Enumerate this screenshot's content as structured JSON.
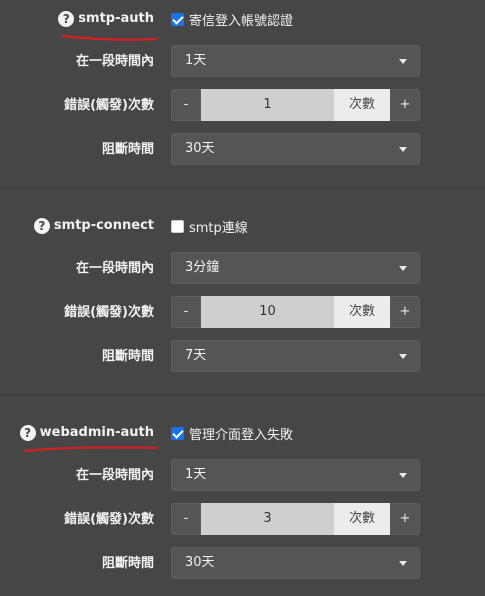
{
  "sections": [
    {
      "name": "smtp-auth",
      "checkbox_label": "寄信登入帳號認證",
      "checked": true,
      "period_label": "在一段時間內",
      "period_value": "1天",
      "count_label": "錯誤(觸發)次數",
      "count_value": "1",
      "count_unit": "次數",
      "block_label": "阻斷時間",
      "block_value": "30天"
    },
    {
      "name": "smtp-connect",
      "checkbox_label": "smtp連線",
      "checked": false,
      "period_label": "在一段時間內",
      "period_value": "3分鐘",
      "count_label": "錯誤(觸發)次數",
      "count_value": "10",
      "count_unit": "次數",
      "block_label": "阻斷時間",
      "block_value": "7天"
    },
    {
      "name": "webadmin-auth",
      "checkbox_label": "管理介面登入失敗",
      "checked": true,
      "period_label": "在一段時間內",
      "period_value": "1天",
      "count_label": "錯誤(觸發)次數",
      "count_value": "3",
      "count_unit": "次數",
      "block_label": "阻斷時間",
      "block_value": "30天"
    }
  ],
  "stepper": {
    "minus": "-",
    "plus": "+"
  },
  "icons": {
    "help": "question-circle-icon",
    "dropdown": "caret-down-icon",
    "check": "check-icon"
  },
  "colors": {
    "background": "#464646",
    "checkbox_on": "#1a73e8",
    "annotation_underline": "#d42020"
  }
}
